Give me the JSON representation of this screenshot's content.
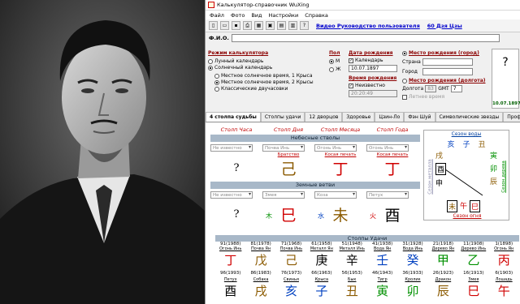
{
  "window": {
    "title": "Калькулятор-справочник WuXing"
  },
  "menu": [
    "Файл",
    "Фото",
    "Вид",
    "Настройки",
    "Справка"
  ],
  "toolbar": {
    "link1": "Видео Руководство пользователя",
    "link2": "60 Дзя Цзы"
  },
  "fio": {
    "label": "Ф.И.О."
  },
  "mode": {
    "title": "Режим калькулятора",
    "lunar": "Лунный календарь",
    "solar": "Солнечный календарь",
    "sub": [
      "Местное солнечное время, 1 Крыса",
      "Местное солнечное время, 2 Крысы",
      "Классические двучасовки"
    ]
  },
  "sex": {
    "title": "Пол",
    "m": "М",
    "f": "Ж"
  },
  "birthdate": {
    "title": "Дата рождения",
    "calendar": "Календарь",
    "value": "10.07.1897"
  },
  "birthtime": {
    "title": "Время рождения",
    "unknown": "Неизвестно",
    "value": "20:20:49"
  },
  "place": {
    "title": "Место рождения (город)",
    "country": "Страна",
    "city": "Город"
  },
  "longitude": {
    "title": "Место рождения (долгота)",
    "lon_label": "Долгота",
    "lon_value": "83",
    "gmt_label": "GMT",
    "gmt_value": "7",
    "summer": "Летнее время"
  },
  "date_display": "10.07.1897",
  "tabs": [
    "4 столпа судьбы",
    "Столпы удачи",
    "12 дворцов",
    "Здоровье",
    "Цзин-Ло",
    "Фэн Шуй",
    "Символические звезды",
    "Профиль карты"
  ],
  "pillars": {
    "headers": [
      "Столп Часа",
      "Столп Дня",
      "Столп Месяца",
      "Столп Года"
    ],
    "heaven_band": "Небесные стволы",
    "heaven_combos": [
      "Не известно",
      "Почва Инь",
      "Огонь Инь",
      "Огонь Инь"
    ],
    "heaven_gods": [
      "",
      "",
      "Братство",
      "Косая печать",
      "Косая печать"
    ],
    "heaven_chars": [
      "?",
      "己",
      "丁",
      "丁"
    ],
    "earth_band": "Земные ветви",
    "earth_combos": [
      "Не известно",
      "Змея",
      "Коза",
      "Петух"
    ],
    "earth_chars": [
      "?",
      "巳",
      "未",
      "酉"
    ],
    "earth_elements": [
      "",
      "木",
      "水",
      "火"
    ]
  },
  "seasons": {
    "water": "Сезон воды",
    "fire": "Сезон огня",
    "wood": "Сезон дерева",
    "metal": "Сезон металла",
    "top": [
      "亥",
      "子",
      "丑"
    ],
    "left": [
      "戌",
      "酉",
      "申"
    ],
    "right": [
      "寅",
      "卯",
      "辰"
    ],
    "bottom": [
      "未",
      "午",
      "巳"
    ]
  },
  "luck": {
    "band": "Столпы Удачи",
    "ages1": [
      "91(1988)",
      "81(1978)",
      "71(1968)",
      "61(1958)",
      "51(1948)",
      "41(1938)",
      "31(1928)",
      "21(1918)",
      "11(1908)",
      "1(1898)"
    ],
    "elems1": [
      "Огонь Инь",
      "Почва Ян",
      "Почва Инь",
      "Металл Ян",
      "Металл Инь",
      "Вода Ян",
      "Вода Инь",
      "Дерево Ян",
      "Дерево Инь",
      "Огонь Ян"
    ],
    "chars1": [
      "丁",
      "戊",
      "己",
      "庚",
      "辛",
      "壬",
      "癸",
      "甲",
      "乙",
      "丙"
    ],
    "ages2": [
      "96(1993)",
      "86(1983)",
      "76(1973)",
      "66(1963)",
      "56(1953)",
      "46(1943)",
      "36(1933)",
      "26(1923)",
      "16(1913)",
      "6(1903)"
    ],
    "animals2": [
      "Петух",
      "Собака",
      "Свинья",
      "Крыса",
      "Бык",
      "Тигр",
      "Кролик",
      "Дракон",
      "Змея",
      "Лошадь"
    ],
    "chars2": [
      "酉",
      "戌",
      "亥",
      "子",
      "丑",
      "寅",
      "卯",
      "辰",
      "巳",
      "午"
    ]
  },
  "colors": {
    "red": "#d00000",
    "blue": "#0040c0",
    "green": "#009000",
    "brown": "#8b5a00",
    "band": "#a8b8c8"
  }
}
